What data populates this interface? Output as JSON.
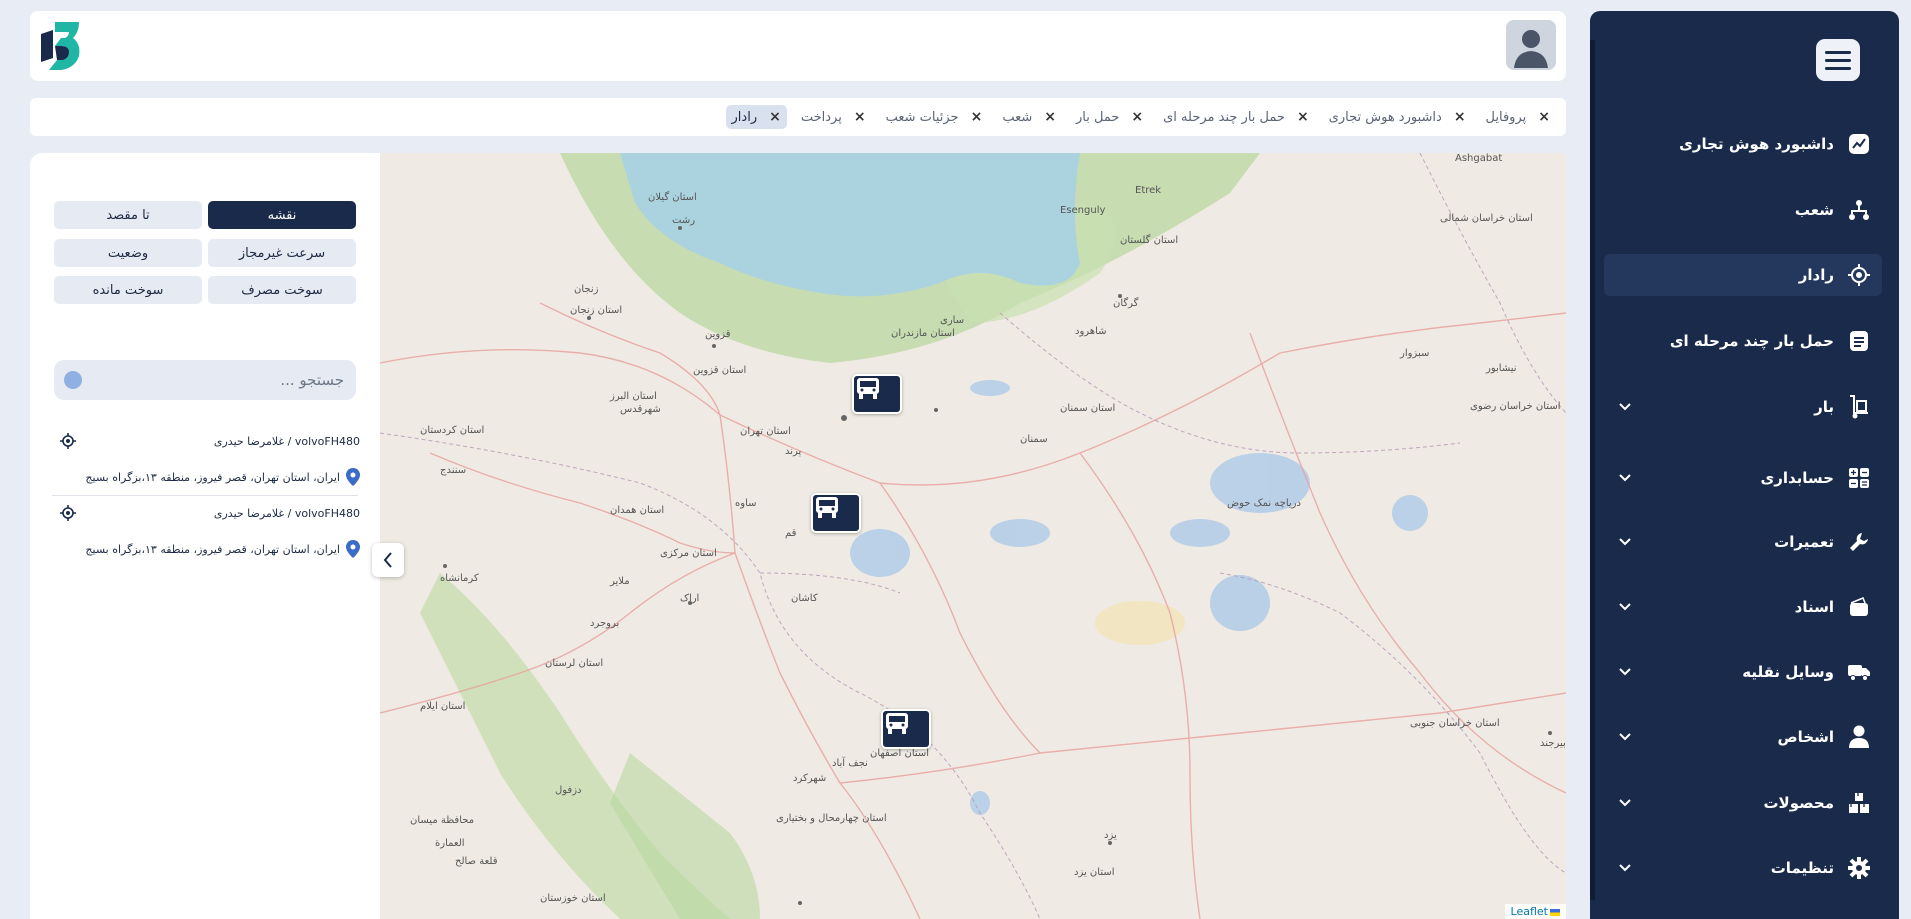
{
  "sidebar": {
    "items": [
      {
        "label": "داشبورد هوش تجاری",
        "icon": "chart-line-icon",
        "has_chevron": false
      },
      {
        "label": "شعب",
        "icon": "branches-icon",
        "has_chevron": false
      },
      {
        "label": "رادار",
        "icon": "radar-icon",
        "has_chevron": false,
        "active": true
      },
      {
        "label": "حمل بار چند مرحله ای",
        "icon": "document-icon",
        "has_chevron": false
      },
      {
        "label": "بار",
        "icon": "hand-truck-icon",
        "has_chevron": true
      },
      {
        "label": "حسابداری",
        "icon": "calculator-icon",
        "has_chevron": true
      },
      {
        "label": "تعمیرات",
        "icon": "wrench-icon",
        "has_chevron": true
      },
      {
        "label": "اسناد",
        "icon": "wallet-icon",
        "has_chevron": true
      },
      {
        "label": "وسایل نقلیه",
        "icon": "truck-icon",
        "has_chevron": true
      },
      {
        "label": "اشخاص",
        "icon": "user-icon",
        "has_chevron": true
      },
      {
        "label": "محصولات",
        "icon": "products-icon",
        "has_chevron": true
      },
      {
        "label": "تنظیمات",
        "icon": "gear-icon",
        "has_chevron": true
      }
    ]
  },
  "tabs": [
    {
      "label": "پروفایل"
    },
    {
      "label": "داشبورد هوش تجاری"
    },
    {
      "label": "حمل بار چند مرحله ای"
    },
    {
      "label": "حمل بار"
    },
    {
      "label": "شعب"
    },
    {
      "label": "جزئیات شعب"
    },
    {
      "label": "پرداخت"
    },
    {
      "label": "رادار",
      "active": true
    }
  ],
  "filters": {
    "map": "نقشه",
    "to_destination": "تا مقصد",
    "overspeed": "سرعت غیرمجاز",
    "status": "وضعیت",
    "fuel_used": "سوخت مصرف",
    "fuel_left": "سوخت مانده"
  },
  "search": {
    "placeholder": "جستجو ..."
  },
  "vehicles": [
    {
      "name": "volvoFH480 / غلامرضا حیدری",
      "address": "ایران، استان تهران، قصر فیروز، منطقه ۱۳،بزگراه بسیج"
    },
    {
      "name": "volvoFH480 / غلامرضا حیدری",
      "address": "ایران، استان تهران، قصر فیروز، منطقه ۱۳،بزگراه بسیج"
    }
  ],
  "map": {
    "attribution": "Leaflet",
    "labels": [
      {
        "text": "استان گیلان"
      },
      {
        "text": "رشت"
      },
      {
        "text": "زنجان"
      },
      {
        "text": "استان زنجان"
      },
      {
        "text": "قزوین"
      },
      {
        "text": "استان قزوین"
      },
      {
        "text": "استان البرز"
      },
      {
        "text": "شهرقدس"
      },
      {
        "text": "استان تهران"
      },
      {
        "text": "ساری"
      },
      {
        "text": "استان مازندران"
      },
      {
        "text": "گرگان"
      },
      {
        "text": "استان گلستان"
      },
      {
        "text": "شاهرود"
      },
      {
        "text": "سمنان"
      },
      {
        "text": "استان سمنان"
      },
      {
        "text": "استان خراسان شمالی"
      },
      {
        "text": "سبزوار"
      },
      {
        "text": "نیشابور"
      },
      {
        "text": "استان خراسان رضوی"
      },
      {
        "text": "Esenguly"
      },
      {
        "text": "Etrek"
      },
      {
        "text": "Ashgabat"
      },
      {
        "text": "استان کردستان"
      },
      {
        "text": "سنندج"
      },
      {
        "text": "ساوه"
      },
      {
        "text": "استان همدان"
      },
      {
        "text": "استان مرکزی"
      },
      {
        "text": "کرمانشاه"
      },
      {
        "text": "ملایر"
      },
      {
        "text": "اراک"
      },
      {
        "text": "قم"
      },
      {
        "text": "کاشان"
      },
      {
        "text": "بروجرد"
      },
      {
        "text": "استان لرستان"
      },
      {
        "text": "استان ایلام"
      },
      {
        "text": "استان اصفهان"
      },
      {
        "text": "نجف آباد"
      },
      {
        "text": "شهرکرد"
      },
      {
        "text": "دزفول"
      },
      {
        "text": "استان چهارمحال و بختیاری"
      },
      {
        "text": "محافظة ميسان"
      },
      {
        "text": "العمارة"
      },
      {
        "text": "قلعة صالح"
      },
      {
        "text": "استان خوزستان"
      },
      {
        "text": "یزد"
      },
      {
        "text": "استان یزد"
      },
      {
        "text": "استان خراسان جنوبی"
      },
      {
        "text": "بیرجند"
      },
      {
        "text": "دریاچه نمک حوض"
      },
      {
        "text": "پرند"
      }
    ]
  }
}
